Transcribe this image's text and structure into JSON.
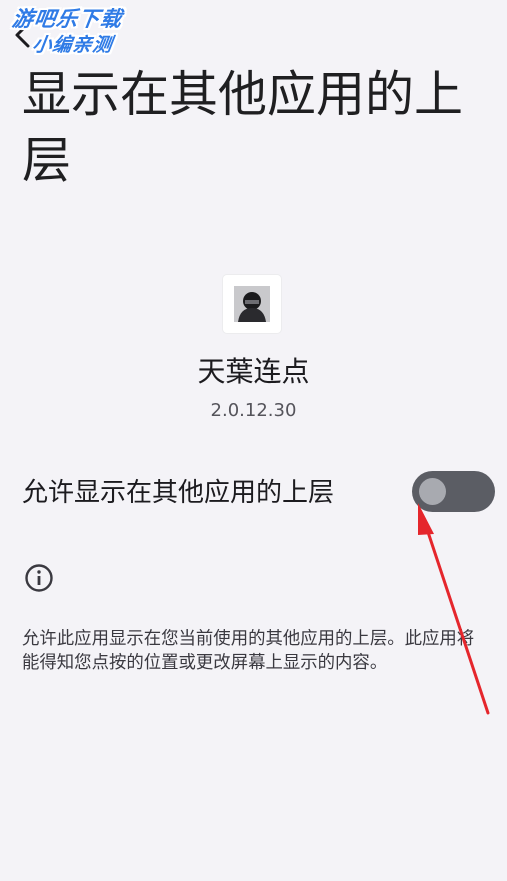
{
  "watermark": {
    "line1": "游吧乐下载",
    "line2": "小编亲测"
  },
  "header": {
    "title": "显示在其他应用的上层"
  },
  "app": {
    "name": "天葉连点",
    "version": "2.0.12.30"
  },
  "permission": {
    "label": "允许显示在其他应用的上层",
    "enabled": false
  },
  "description": "允许此应用显示在您当前使用的其他应用的上层。此应用将能得知您点按的位置或更改屏幕上显示的内容。",
  "colors": {
    "background": "#f4f3f7",
    "toggle_track_off": "#5b5d64",
    "toggle_thumb_off": "#a8aab0",
    "annotation_arrow": "#e5262c"
  },
  "icons": {
    "back": "back-arrow-icon",
    "info": "info-icon"
  }
}
